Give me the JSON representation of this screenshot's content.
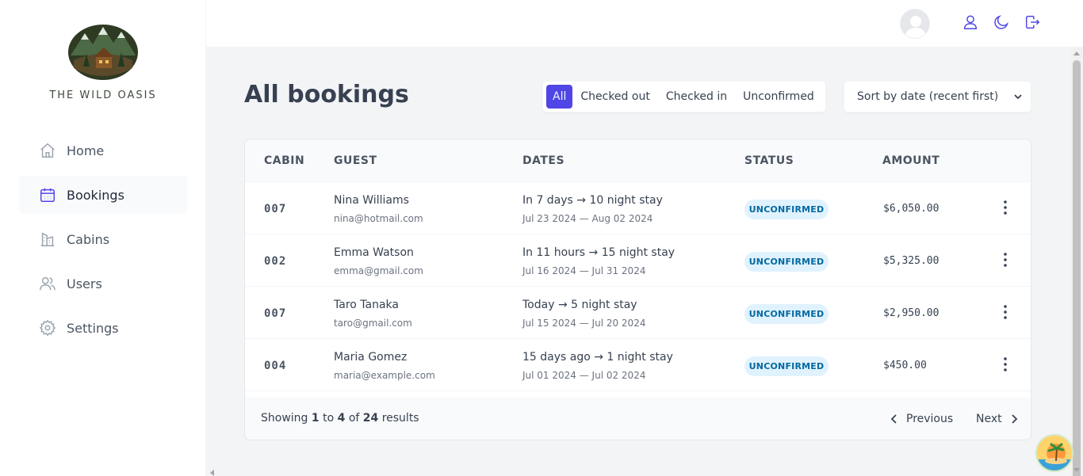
{
  "brand": {
    "name": "THE WILD OASIS"
  },
  "nav": [
    {
      "label": "Home",
      "icon": "home-icon"
    },
    {
      "label": "Bookings",
      "icon": "calendar-icon",
      "active": true
    },
    {
      "label": "Cabins",
      "icon": "cabins-icon"
    },
    {
      "label": "Users",
      "icon": "users-icon"
    },
    {
      "label": "Settings",
      "icon": "gear-icon"
    }
  ],
  "header": {
    "icons": [
      "user-icon",
      "moon-icon",
      "logout-icon"
    ]
  },
  "page": {
    "title": "All bookings"
  },
  "filter": {
    "options": [
      "All",
      "Checked out",
      "Checked in",
      "Unconfirmed"
    ],
    "active": "All"
  },
  "sort": {
    "selected": "Sort by date (recent first)"
  },
  "table": {
    "headers": [
      "CABIN",
      "GUEST",
      "DATES",
      "STATUS",
      "AMOUNT"
    ],
    "rows": [
      {
        "cabin": "007",
        "name": "Nina Williams",
        "email": "nina@hotmail.com",
        "dates": "In 7 days → 10 night stay",
        "range": "Jul 23 2024 — Aug 02 2024",
        "status": "UNCONFIRMED",
        "amount": "$6,050.00"
      },
      {
        "cabin": "002",
        "name": "Emma Watson",
        "email": "emma@gmail.com",
        "dates": "In 11 hours → 15 night stay",
        "range": "Jul 16 2024 — Jul 31 2024",
        "status": "UNCONFIRMED",
        "amount": "$5,325.00"
      },
      {
        "cabin": "007",
        "name": "Taro Tanaka",
        "email": "taro@gmail.com",
        "dates": "Today → 5 night stay",
        "range": "Jul 15 2024 — Jul 20 2024",
        "status": "UNCONFIRMED",
        "amount": "$2,950.00"
      },
      {
        "cabin": "004",
        "name": "Maria Gomez",
        "email": "maria@example.com",
        "dates": "15 days ago → 1 night stay",
        "range": "Jul 01 2024 — Jul 02 2024",
        "status": "UNCONFIRMED",
        "amount": "$450.00"
      }
    ]
  },
  "pagination": {
    "showing": "Showing",
    "from": "1",
    "to_word": "to",
    "to": "4",
    "of_word": "of",
    "total": "24",
    "results_word": "results",
    "previous": "Previous",
    "next": "Next"
  },
  "colors": {
    "brand": "#4f46e5",
    "badge_bg": "#e0f2fe",
    "badge_text": "#0369a1"
  }
}
